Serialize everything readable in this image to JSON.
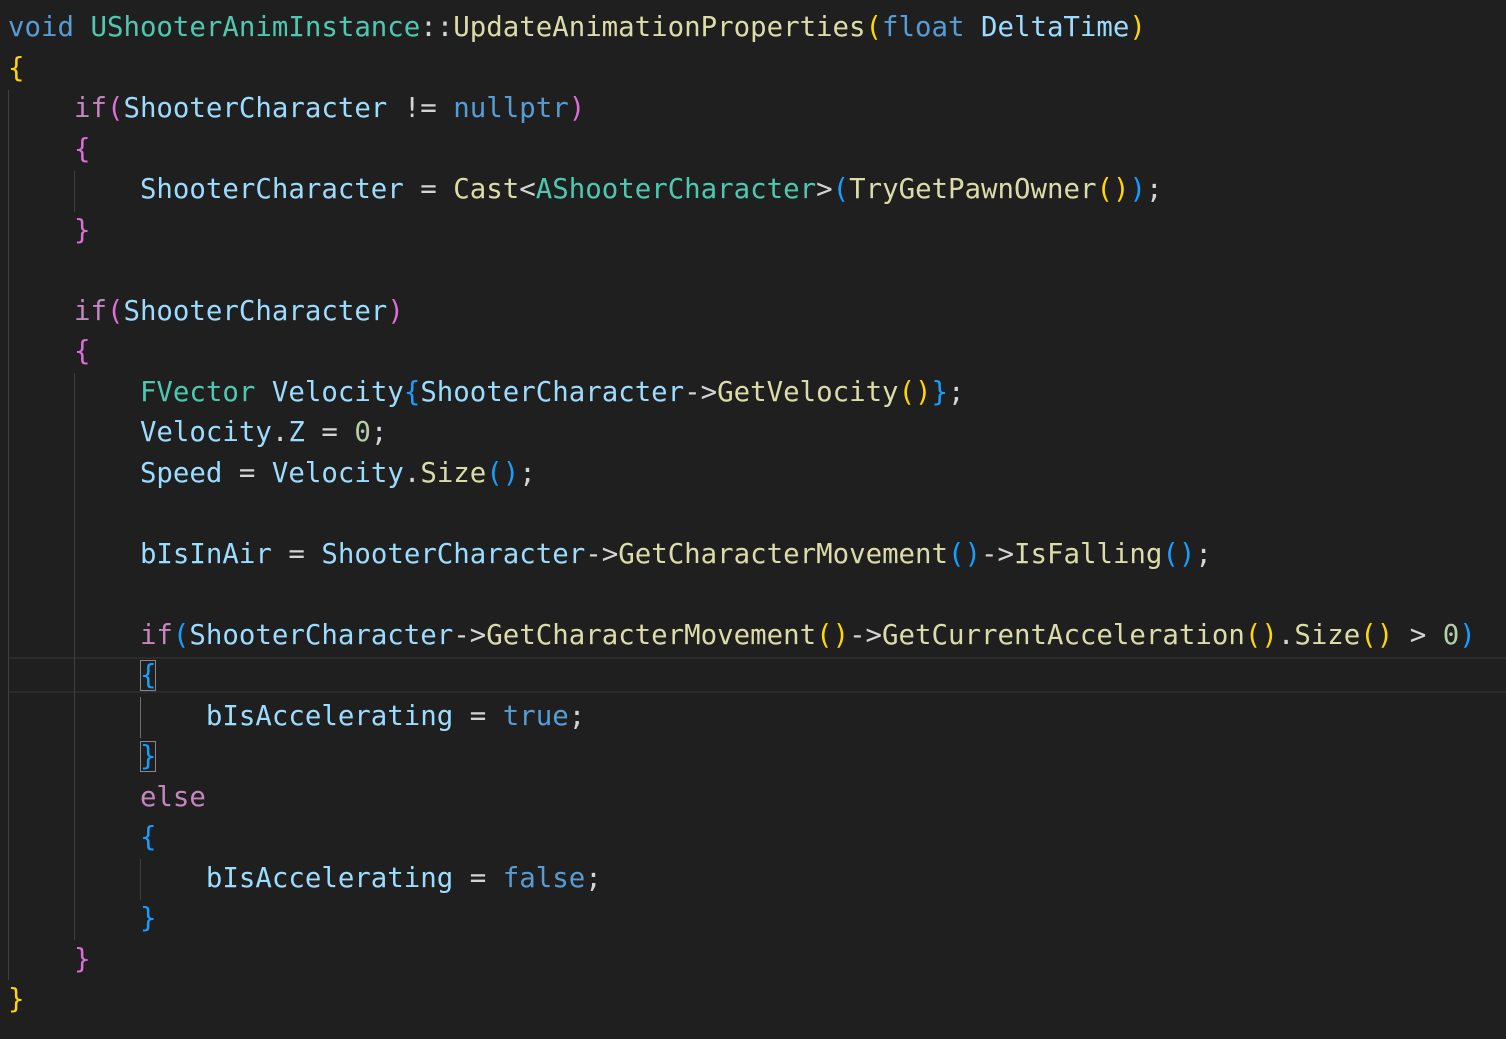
{
  "editor": {
    "language": "C++",
    "colors": {
      "background": "#1f1f1f",
      "keyword_storage": "#569cd6",
      "keyword_control": "#c586c0",
      "type": "#4ec9b0",
      "function": "#dcdcaa",
      "variable": "#9cdcfe",
      "number": "#b5cea8",
      "operator": "#d4d4d4",
      "bracket_level1": "#ffd700",
      "bracket_level2": "#da70d6",
      "bracket_level3": "#179fff"
    },
    "lines": [
      [
        {
          "t": "void",
          "c": "kw"
        },
        {
          "t": " ",
          "c": "p"
        },
        {
          "t": "UShooterAnimInstance",
          "c": "ty"
        },
        {
          "t": "::",
          "c": "op"
        },
        {
          "t": "UpdateAnimationProperties",
          "c": "fn"
        },
        {
          "t": "(",
          "c": "b1"
        },
        {
          "t": "float",
          "c": "kw"
        },
        {
          "t": " ",
          "c": "p"
        },
        {
          "t": "DeltaTime",
          "c": "var"
        },
        {
          "t": ")",
          "c": "b1"
        }
      ],
      [
        {
          "t": "{",
          "c": "b1"
        }
      ],
      [
        {
          "t": "    ",
          "c": "p"
        },
        {
          "t": "if",
          "c": "ctl"
        },
        {
          "t": "(",
          "c": "b2"
        },
        {
          "t": "ShooterCharacter",
          "c": "var"
        },
        {
          "t": " ",
          "c": "p"
        },
        {
          "t": "!=",
          "c": "op"
        },
        {
          "t": " ",
          "c": "p"
        },
        {
          "t": "nullptr",
          "c": "kw"
        },
        {
          "t": ")",
          "c": "b2"
        }
      ],
      [
        {
          "t": "    ",
          "c": "p"
        },
        {
          "t": "{",
          "c": "b2"
        }
      ],
      [
        {
          "t": "        ",
          "c": "p"
        },
        {
          "t": "ShooterCharacter",
          "c": "var"
        },
        {
          "t": " ",
          "c": "p"
        },
        {
          "t": "=",
          "c": "op"
        },
        {
          "t": " ",
          "c": "p"
        },
        {
          "t": "Cast",
          "c": "fn"
        },
        {
          "t": "<",
          "c": "op"
        },
        {
          "t": "AShooterCharacter",
          "c": "ty"
        },
        {
          "t": ">",
          "c": "op"
        },
        {
          "t": "(",
          "c": "b3"
        },
        {
          "t": "TryGetPawnOwner",
          "c": "fn"
        },
        {
          "t": "()",
          "c": "b1"
        },
        {
          "t": ")",
          "c": "b3"
        },
        {
          "t": ";",
          "c": "op"
        }
      ],
      [
        {
          "t": "    ",
          "c": "p"
        },
        {
          "t": "}",
          "c": "b2"
        }
      ],
      [],
      [
        {
          "t": "    ",
          "c": "p"
        },
        {
          "t": "if",
          "c": "ctl"
        },
        {
          "t": "(",
          "c": "b2"
        },
        {
          "t": "ShooterCharacter",
          "c": "var"
        },
        {
          "t": ")",
          "c": "b2"
        }
      ],
      [
        {
          "t": "    ",
          "c": "p"
        },
        {
          "t": "{",
          "c": "b2"
        }
      ],
      [
        {
          "t": "        ",
          "c": "p"
        },
        {
          "t": "FVector",
          "c": "ty"
        },
        {
          "t": " ",
          "c": "p"
        },
        {
          "t": "Velocity",
          "c": "var"
        },
        {
          "t": "{",
          "c": "b3"
        },
        {
          "t": "ShooterCharacter",
          "c": "var"
        },
        {
          "t": "->",
          "c": "op"
        },
        {
          "t": "GetVelocity",
          "c": "fn"
        },
        {
          "t": "()",
          "c": "b1"
        },
        {
          "t": "}",
          "c": "b3"
        },
        {
          "t": ";",
          "c": "op"
        }
      ],
      [
        {
          "t": "        ",
          "c": "p"
        },
        {
          "t": "Velocity",
          "c": "var"
        },
        {
          "t": ".",
          "c": "op"
        },
        {
          "t": "Z",
          "c": "var"
        },
        {
          "t": " ",
          "c": "p"
        },
        {
          "t": "=",
          "c": "op"
        },
        {
          "t": " ",
          "c": "p"
        },
        {
          "t": "0",
          "c": "num"
        },
        {
          "t": ";",
          "c": "op"
        }
      ],
      [
        {
          "t": "        ",
          "c": "p"
        },
        {
          "t": "Speed",
          "c": "var"
        },
        {
          "t": " ",
          "c": "p"
        },
        {
          "t": "=",
          "c": "op"
        },
        {
          "t": " ",
          "c": "p"
        },
        {
          "t": "Velocity",
          "c": "var"
        },
        {
          "t": ".",
          "c": "op"
        },
        {
          "t": "Size",
          "c": "fn"
        },
        {
          "t": "()",
          "c": "b3"
        },
        {
          "t": ";",
          "c": "op"
        }
      ],
      [],
      [
        {
          "t": "        ",
          "c": "p"
        },
        {
          "t": "bIsInAir",
          "c": "var"
        },
        {
          "t": " ",
          "c": "p"
        },
        {
          "t": "=",
          "c": "op"
        },
        {
          "t": " ",
          "c": "p"
        },
        {
          "t": "ShooterCharacter",
          "c": "var"
        },
        {
          "t": "->",
          "c": "op"
        },
        {
          "t": "GetCharacterMovement",
          "c": "fn"
        },
        {
          "t": "()",
          "c": "b3"
        },
        {
          "t": "->",
          "c": "op"
        },
        {
          "t": "IsFalling",
          "c": "fn"
        },
        {
          "t": "()",
          "c": "b3"
        },
        {
          "t": ";",
          "c": "op"
        }
      ],
      [],
      [
        {
          "t": "        ",
          "c": "p"
        },
        {
          "t": "if",
          "c": "ctl"
        },
        {
          "t": "(",
          "c": "b3"
        },
        {
          "t": "ShooterCharacter",
          "c": "var"
        },
        {
          "t": "->",
          "c": "op"
        },
        {
          "t": "GetCharacterMovement",
          "c": "fn"
        },
        {
          "t": "()",
          "c": "b1"
        },
        {
          "t": "->",
          "c": "op"
        },
        {
          "t": "GetCurrentAcceleration",
          "c": "fn"
        },
        {
          "t": "()",
          "c": "b1"
        },
        {
          "t": ".",
          "c": "op"
        },
        {
          "t": "Size",
          "c": "fn"
        },
        {
          "t": "()",
          "c": "b1"
        },
        {
          "t": " ",
          "c": "p"
        },
        {
          "t": ">",
          "c": "op"
        },
        {
          "t": " ",
          "c": "p"
        },
        {
          "t": "0",
          "c": "num"
        },
        {
          "t": ")",
          "c": "b3"
        }
      ],
      [
        {
          "t": "        ",
          "c": "p"
        },
        {
          "t": "{",
          "c": "b3",
          "m": true
        }
      ],
      [
        {
          "t": "            ",
          "c": "p"
        },
        {
          "t": "bIsAccelerating",
          "c": "var"
        },
        {
          "t": " ",
          "c": "p"
        },
        {
          "t": "=",
          "c": "op"
        },
        {
          "t": " ",
          "c": "p"
        },
        {
          "t": "true",
          "c": "kw"
        },
        {
          "t": ";",
          "c": "op"
        }
      ],
      [
        {
          "t": "        ",
          "c": "p"
        },
        {
          "t": "}",
          "c": "b3",
          "m": true
        }
      ],
      [
        {
          "t": "        ",
          "c": "p"
        },
        {
          "t": "else",
          "c": "ctl"
        }
      ],
      [
        {
          "t": "        ",
          "c": "p"
        },
        {
          "t": "{",
          "c": "b3"
        }
      ],
      [
        {
          "t": "            ",
          "c": "p"
        },
        {
          "t": "bIsAccelerating",
          "c": "var"
        },
        {
          "t": " ",
          "c": "p"
        },
        {
          "t": "=",
          "c": "op"
        },
        {
          "t": " ",
          "c": "p"
        },
        {
          "t": "false",
          "c": "kw"
        },
        {
          "t": ";",
          "c": "op"
        }
      ],
      [
        {
          "t": "        ",
          "c": "p"
        },
        {
          "t": "}",
          "c": "b3"
        }
      ],
      [
        {
          "t": "    ",
          "c": "p"
        },
        {
          "t": "}",
          "c": "b2"
        }
      ],
      [
        {
          "t": "}",
          "c": "b1"
        }
      ]
    ]
  }
}
